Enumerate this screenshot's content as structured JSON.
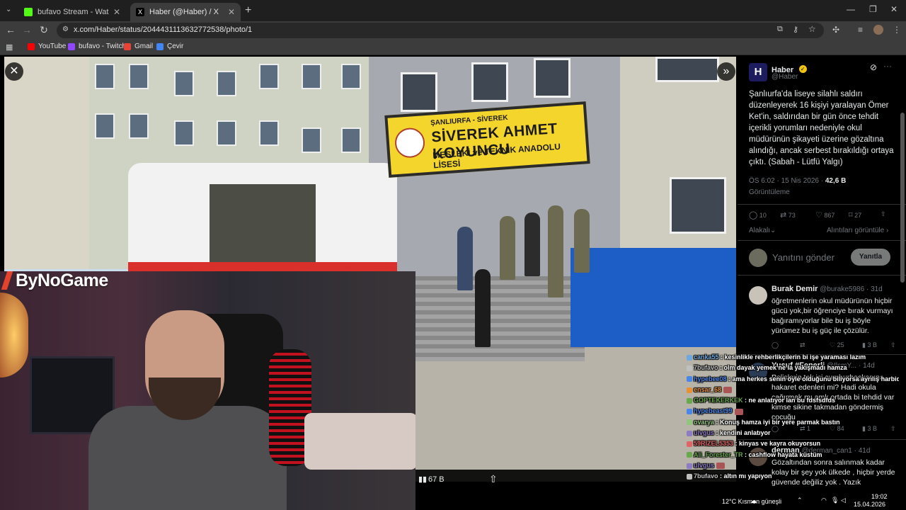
{
  "browser": {
    "tabs": [
      {
        "label": "bufavo Stream - Watch Live on",
        "color": "#53fc18"
      },
      {
        "label": "Haber (@Haber) / X",
        "color": "#000000"
      }
    ],
    "new_tab": "+",
    "url": "x.com/Haber/status/2044431113632772538/photo/1",
    "bookmarks": [
      {
        "label": "YouTube",
        "color": "#ff0000"
      },
      {
        "label": "bufavo - Twitch",
        "color": "#9146ff"
      },
      {
        "label": "Gmail",
        "color": "#ea4335"
      },
      {
        "label": "Çevir",
        "color": "#4285f4"
      }
    ]
  },
  "photo": {
    "sign_line1": "ŞANLIURFA - SİVEREK",
    "sign_line2": "SİVEREK AHMET KOYUNCU",
    "sign_line3": "MESLEKİ ve TEKNİK ANADOLU LİSESİ",
    "views": "67 B"
  },
  "stream": {
    "brand": "ByNoGame"
  },
  "tweet": {
    "name": "Haber",
    "handle": "@Haber",
    "text": "Şanlıurfa'da liseye silahlı saldırı düzenleyerek 16 kişiyi yaralayan Ömer Ket'in, saldırıdan bir gün önce tehdit içerikli yorumları nedeniyle okul müdürünün şikayeti üzerine gözaltına alındığı, ancak serbest bırakıldığı ortaya çıktı. (Sabah - Lütfü Yalgı)",
    "timestamp": "ÖS 6:02 · 15 Nis 2026 · ",
    "views_count": "42,6 B",
    "views_label": "Görüntüleme",
    "actions": {
      "replies": "10",
      "reposts": "73",
      "likes": "867",
      "bookmarks": "27"
    },
    "related": "Alakalı",
    "quotes": "Alıntıları görüntüle",
    "reply_placeholder": "Yanıtını gönder",
    "reply_button": "Yanıtla"
  },
  "replies": [
    {
      "name": "Burak Demir",
      "handle": "@burake5986 · 31d",
      "text": "öğretmenlerin okul müdürünün hiçbir gücü yok,bir öğrenciye bırak vurmayı bağıramıyorlar bile bu iş böyle yürümez bu iş güç ile çözülür.",
      "stats": {
        "replies": "",
        "reposts": "",
        "likes": "25",
        "views": "3 B"
      },
      "avatar_color": "#c8c2b8"
    },
    {
      "name": "Yusuf #Fenerli",
      "handle": "@IlsmY... · 14d",
      "text": "Polislerin tek işi cumhurbaşkanına hakaret edenleri mi? Hadi okula çağırmak mı amk ortada bi tehdid var kimse sikine takmadan göndermiş cocuğu",
      "stats": {
        "replies": "",
        "reposts": "1",
        "likes": "84",
        "views": "3 B"
      },
      "avatar_color": "#2a3b55"
    },
    {
      "name": "derman",
      "handle": "@derman_can1 · 41d",
      "text": "Gözaltından sonra salınmak kadar kolay bir şey yok ülkede , hiçbir yerde güvende değiliz yok . Yazık",
      "stats": {
        "replies": "",
        "reposts": "",
        "likes": "",
        "views": ""
      },
      "avatar_color": "#5a4a40"
    }
  ],
  "chat": [
    {
      "user": "canka55",
      "msg": "kesinlikle rehberlikçilerin bi işe yaraması lazım",
      "color": "#6fa8dc"
    },
    {
      "user": "7bufavo",
      "msg": "olm dayak yemek ne la yakışmadı hamza",
      "color": "#c0c0c0"
    },
    {
      "user": "hypebee08",
      "msg": "ama herkes senin öyle olduğunu biliyorsa ayrılış harbiden sorması lazım",
      "color": "#4a86e8"
    },
    {
      "user": "ensar_68",
      "msg": "",
      "color": "#e69138"
    },
    {
      "user": "GOPTEKERKEK",
      "msg": "ne anlatıyor lan bu fdsfsdfds",
      "color": "#6aa84f"
    },
    {
      "user": "hypebeast99",
      "msg": "",
      "color": "#4a86e8"
    },
    {
      "user": "ovarya",
      "msg": "Konuş hamza iyi bir yere parmak bastın",
      "color": "#93c47d"
    },
    {
      "user": "ulvgus",
      "msg": "kendini anlatıyor",
      "color": "#8e7cc3"
    },
    {
      "user": "59RIZEL5353",
      "msg": "kinyas ve kayra okuyorsun",
      "color": "#e06666"
    },
    {
      "user": "Ali_Forester_TR",
      "msg": "cashflow hayata küstüm",
      "color": "#6aa84f"
    },
    {
      "user": "ulvgus",
      "msg": "",
      "color": "#8e7cc3"
    },
    {
      "user": "7bufavo",
      "msg": "altın mı yapıyon",
      "color": "#c0c0c0"
    }
  ],
  "taskbar": {
    "weather": "12°C   Kısmen güneşli",
    "time": "19:02",
    "date": "15.04.2026"
  }
}
